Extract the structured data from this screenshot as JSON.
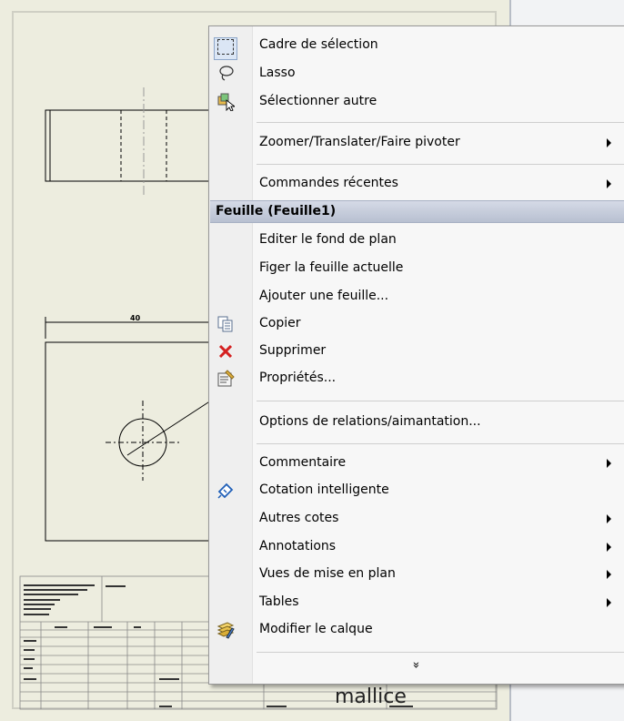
{
  "drawing": {
    "dimension_value": "40",
    "watermark_text": "mallice"
  },
  "context_menu": {
    "top_items": [
      {
        "label": "Cadre de sélection",
        "icon": "selection-box-icon"
      },
      {
        "label": "Lasso",
        "icon": "lasso-icon"
      },
      {
        "label": "Sélectionner autre",
        "icon": "select-other-icon"
      }
    ],
    "zoom_item": {
      "label": "Zoomer/Translater/Faire pivoter",
      "has_submenu": true
    },
    "recent_item": {
      "label": "Commandes récentes",
      "has_submenu": true
    },
    "section_header": "Feuille (Feuille1)",
    "sheet_items": [
      {
        "label": "Editer le fond de plan"
      },
      {
        "label": "Figer la feuille actuelle"
      },
      {
        "label": "Ajouter une feuille..."
      },
      {
        "label": "Copier",
        "icon": "copy-icon"
      },
      {
        "label": "Supprimer",
        "icon": "delete-icon"
      },
      {
        "label": "Propriétés...",
        "icon": "properties-icon"
      }
    ],
    "options_item": {
      "label": "Options de relations/aimantation..."
    },
    "bottom_items": [
      {
        "label": "Commentaire",
        "has_submenu": true
      },
      {
        "label": "Cotation intelligente",
        "icon": "smart-dimension-icon"
      },
      {
        "label": "Autres cotes",
        "has_submenu": true
      },
      {
        "label": "Annotations",
        "has_submenu": true
      },
      {
        "label": "Vues de mise en plan",
        "has_submenu": true
      },
      {
        "label": "Tables",
        "has_submenu": true
      },
      {
        "label": "Modifier le calque",
        "icon": "change-layer-icon"
      }
    ],
    "expand_glyph": "»"
  }
}
